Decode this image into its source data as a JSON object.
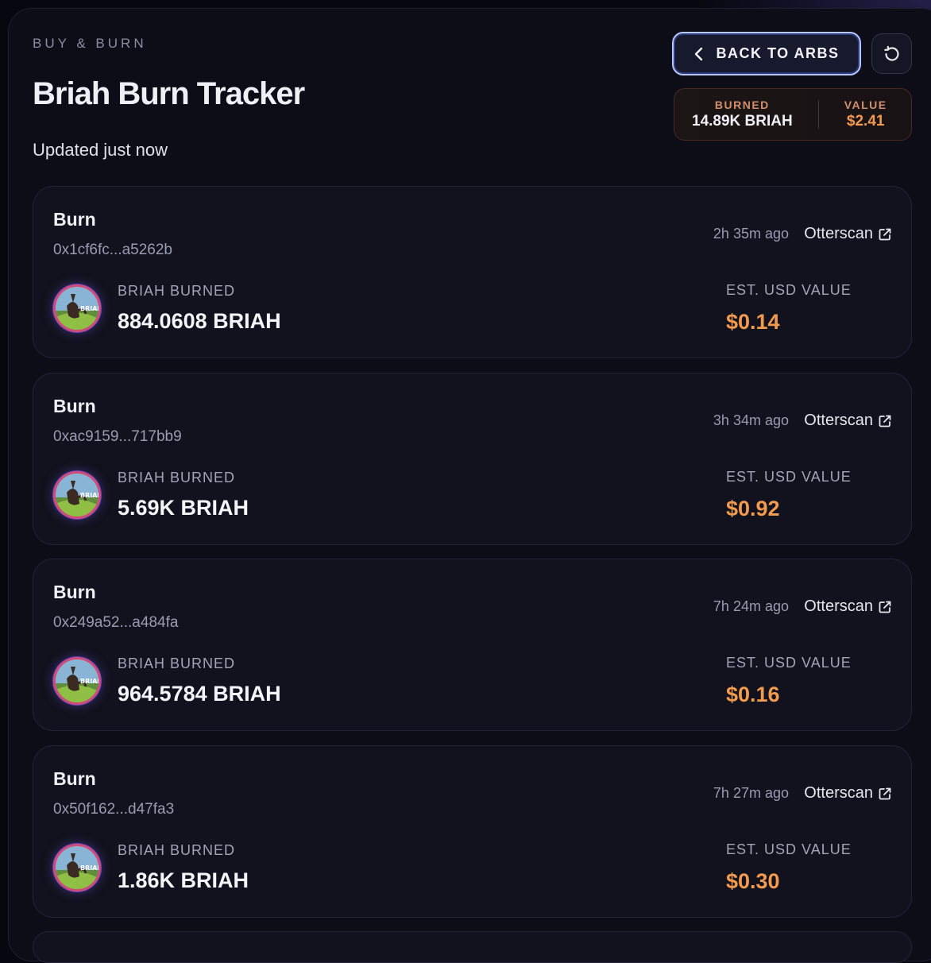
{
  "header": {
    "eyebrow": "BUY & BURN",
    "title": "Briah Burn Tracker",
    "updated": "Updated just now",
    "back_label": "BACK TO ARBS"
  },
  "summary": {
    "burned_label": "BURNED",
    "burned_value": "14.89K BRIAH",
    "value_label": "VALUE",
    "value_value": "$2.41"
  },
  "colors": {
    "accent_orange": "#f29a4e",
    "background": "#0d0d18",
    "card": "#11121d",
    "button_border": "#b8c8ff"
  },
  "burns": [
    {
      "type": "Burn",
      "hash": "0x1cf6fc...a5262b",
      "time": "2h 35m ago",
      "link": "Otterscan",
      "burned_label": "BRIAH BURNED",
      "amount": "884.0608 BRIAH",
      "usd_label": "EST. USD VALUE",
      "usd": "$0.14"
    },
    {
      "type": "Burn",
      "hash": "0xac9159...717bb9",
      "time": "3h 34m ago",
      "link": "Otterscan",
      "burned_label": "BRIAH BURNED",
      "amount": "5.69K BRIAH",
      "usd_label": "EST. USD VALUE",
      "usd": "$0.92"
    },
    {
      "type": "Burn",
      "hash": "0x249a52...a484fa",
      "time": "7h 24m ago",
      "link": "Otterscan",
      "burned_label": "BRIAH BURNED",
      "amount": "964.5784 BRIAH",
      "usd_label": "EST. USD VALUE",
      "usd": "$0.16"
    },
    {
      "type": "Burn",
      "hash": "0x50f162...d47fa3",
      "time": "7h 27m ago",
      "link": "Otterscan",
      "burned_label": "BRIAH BURNED",
      "amount": "1.86K BRIAH",
      "usd_label": "EST. USD VALUE",
      "usd": "$0.30"
    }
  ],
  "icons": {
    "back": "chevron-left-icon",
    "refresh": "refresh-icon",
    "external": "external-link-icon",
    "token": "briah-token-avatar"
  }
}
